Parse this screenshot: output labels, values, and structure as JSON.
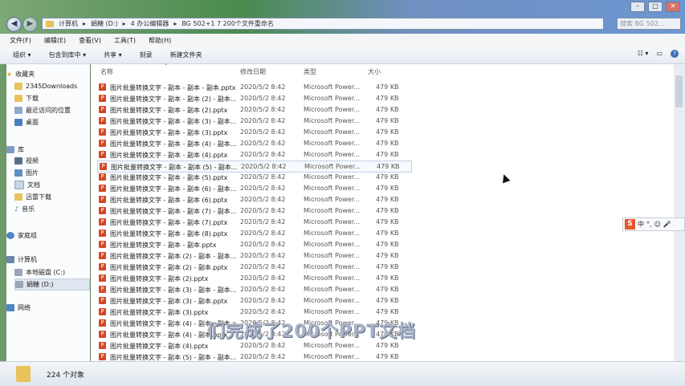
{
  "address": {
    "segments": [
      "计算机",
      "娟糖 (D:)",
      "4 办公编辑器",
      "BG 502+1 7 200个文件重命名"
    ],
    "search_placeholder": "搜索 BG 502..."
  },
  "menu": [
    "文件(F)",
    "编辑(E)",
    "查看(V)",
    "工具(T)",
    "帮助(H)"
  ],
  "toolbar": {
    "organize": "组织 ▾",
    "include": "包含到库中 ▾",
    "share": "共享 ▾",
    "burn": "刻录",
    "new_folder": "新建文件夹"
  },
  "sidebar": {
    "favorites_header": "收藏夹",
    "favorites": [
      "2345Downloads",
      "下载",
      "最近访问的位置",
      "桌面"
    ],
    "library_header": "库",
    "library": [
      "视频",
      "图片",
      "文档",
      "迅雷下载",
      "音乐"
    ],
    "homegroup": "家庭组",
    "computer_header": "计算机",
    "drives": [
      "本地磁盘 (C:)",
      "娟糖 (D:)"
    ],
    "network": "网络"
  },
  "columns": {
    "name": "名称",
    "date": "修改日期",
    "type": "类型",
    "size": "大小"
  },
  "files": [
    {
      "name": "图片批量转换文字 - 副本 - 副本 - 副本.pptx",
      "date": "2020/5/2 8:42",
      "type": "Microsoft Power...",
      "size": "479 KB"
    },
    {
      "name": "图片批量转换文字 - 副本 - 副本 (2) - 副本...",
      "date": "2020/5/2 8:42",
      "type": "Microsoft Power...",
      "size": "479 KB"
    },
    {
      "name": "图片批量转换文字 - 副本 - 副本 (2).pptx",
      "date": "2020/5/2 8:42",
      "type": "Microsoft Power...",
      "size": "479 KB"
    },
    {
      "name": "图片批量转换文字 - 副本 - 副本 (3) - 副本...",
      "date": "2020/5/2 8:42",
      "type": "Microsoft Power...",
      "size": "479 KB"
    },
    {
      "name": "图片批量转换文字 - 副本 - 副本 (3).pptx",
      "date": "2020/5/2 8:42",
      "type": "Microsoft Power...",
      "size": "479 KB"
    },
    {
      "name": "图片批量转换文字 - 副本 - 副本 (4) - 副本...",
      "date": "2020/5/2 8:42",
      "type": "Microsoft Power...",
      "size": "479 KB"
    },
    {
      "name": "图片批量转换文字 - 副本 - 副本 (4).pptx",
      "date": "2020/5/2 8:42",
      "type": "Microsoft Power...",
      "size": "479 KB"
    },
    {
      "name": "图片批量转换文字 - 副本 - 副本 (5) - 副本...",
      "date": "2020/5/2 8:42",
      "type": "Microsoft Power...",
      "size": "479 KB"
    },
    {
      "name": "图片批量转换文字 - 副本 - 副本 (5).pptx",
      "date": "2020/5/2 8:42",
      "type": "Microsoft Power...",
      "size": "479 KB"
    },
    {
      "name": "图片批量转换文字 - 副本 - 副本 (6) - 副本...",
      "date": "2020/5/2 8:42",
      "type": "Microsoft Power...",
      "size": "479 KB"
    },
    {
      "name": "图片批量转换文字 - 副本 - 副本 (6).pptx",
      "date": "2020/5/2 8:42",
      "type": "Microsoft Power...",
      "size": "479 KB"
    },
    {
      "name": "图片批量转换文字 - 副本 - 副本 (7) - 副本...",
      "date": "2020/5/2 8:42",
      "type": "Microsoft Power...",
      "size": "479 KB"
    },
    {
      "name": "图片批量转换文字 - 副本 - 副本 (7).pptx",
      "date": "2020/5/2 8:42",
      "type": "Microsoft Power...",
      "size": "479 KB"
    },
    {
      "name": "图片批量转换文字 - 副本 - 副本 (8).pptx",
      "date": "2020/5/2 8:42",
      "type": "Microsoft Power...",
      "size": "479 KB"
    },
    {
      "name": "图片批量转换文字 - 副本 - 副本.pptx",
      "date": "2020/5/2 8:42",
      "type": "Microsoft Power...",
      "size": "479 KB"
    },
    {
      "name": "图片批量转换文字 - 副本 (2) - 副本 - 副本...",
      "date": "2020/5/2 8:42",
      "type": "Microsoft Power...",
      "size": "479 KB"
    },
    {
      "name": "图片批量转换文字 - 副本 (2) - 副本.pptx",
      "date": "2020/5/2 8:42",
      "type": "Microsoft Power...",
      "size": "479 KB"
    },
    {
      "name": "图片批量转换文字 - 副本 (2).pptx",
      "date": "2020/5/2 8:42",
      "type": "Microsoft Power...",
      "size": "479 KB"
    },
    {
      "name": "图片批量转换文字 - 副本 (3) - 副本 - 副本...",
      "date": "2020/5/2 8:42",
      "type": "Microsoft Power...",
      "size": "479 KB"
    },
    {
      "name": "图片批量转换文字 - 副本 (3) - 副本.pptx",
      "date": "2020/5/2 8:42",
      "type": "Microsoft Power...",
      "size": "479 KB"
    },
    {
      "name": "图片批量转换文字 - 副本 (3).pptx",
      "date": "2020/5/2 8:42",
      "type": "Microsoft Power...",
      "size": "479 KB"
    },
    {
      "name": "图片批量转换文字 - 副本 (4) - 副本 - 副本...",
      "date": "2020/5/2 8:42",
      "type": "Microsoft Power...",
      "size": "479 KB"
    },
    {
      "name": "图片批量转换文字 - 副本 (4) - 副本.pptx",
      "date": "2020/5/2 8:42",
      "type": "Microsoft Power...",
      "size": "479 KB"
    },
    {
      "name": "图片批量转换文字 - 副本 (4).pptx",
      "date": "2020/5/2 8:42",
      "type": "Microsoft Power...",
      "size": "479 KB"
    },
    {
      "name": "图片批量转换文字 - 副本 (5) - 副本 - 副本...",
      "date": "2020/5/2 8:42",
      "type": "Microsoft Power...",
      "size": "479 KB"
    }
  ],
  "selected_index": 7,
  "status": {
    "count": "224 个对象"
  },
  "caption": "们完成了200个PPT文档",
  "ime": {
    "label": "中"
  },
  "colors": {
    "ppt_icon": "#d24726",
    "selection": "#dfe6ef"
  }
}
